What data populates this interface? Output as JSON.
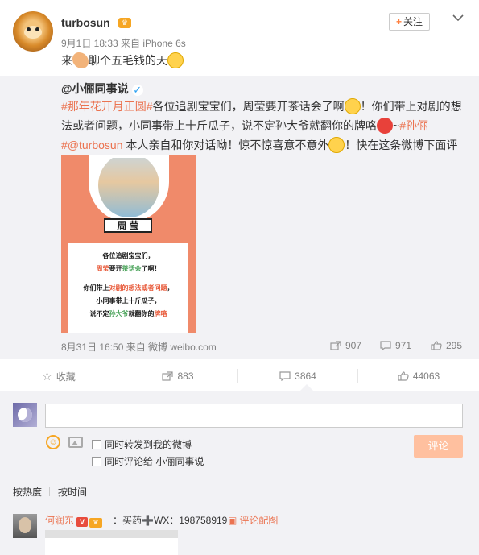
{
  "post": {
    "author": "turbosun",
    "vip_badge": "♛",
    "meta": "9月1日 18:33 来自 iPhone 6s",
    "text_before": "来",
    "text_middle": "聊个五毛钱的天",
    "follow_label": "关注",
    "follow_plus": "+",
    "more_icon": "chevron-down-icon"
  },
  "repost": {
    "author": "@小俪同事说",
    "verified": "✓",
    "topic": "#那年花开月正圆#",
    "p1": "各位追剧宝宝们，周莹要开茶话会了啊",
    "p2": "！你们带上对剧的想法或者问题，小同事带上十斤瓜子，说不定孙大爷就翻你的牌咯",
    "p3": "~",
    "mention1": "#孙俪#",
    "mention2": "@turbosun",
    "p4": " 本人亲自和你对话呦！惊不惊喜意不意外",
    "p5": "！快在这条微博下面评论起来吧！",
    "image": {
      "nameplate": "周 莹",
      "line1": "各位追剧宝宝们，",
      "line2a": "周莹",
      "line2b": "要开",
      "line2c": "茶话会",
      "line2d": "了啊！",
      "line3a": "你们带上",
      "line3b": "对剧的想法或者问题",
      "line3c": "，",
      "line4": "小同事带上十斤瓜子，",
      "line5a": "说不定",
      "line5b": "孙大爷",
      "line5c": "就翻你的",
      "line5d": "牌咯"
    },
    "meta": "8月31日 16:50 来自 微博 weibo.com",
    "reposts": "907",
    "comments": "971",
    "likes": "295"
  },
  "actions": {
    "favorite": "收藏",
    "repost": "883",
    "comment": "3864",
    "like": "44063"
  },
  "comment_box": {
    "placeholder": "",
    "check1": "同时转发到我的微博",
    "check2": "同时评论给 小俪同事说",
    "submit": "评论",
    "emoji": "☺"
  },
  "sort": {
    "by_hot": "按热度",
    "by_time": "按时间"
  },
  "top_comment": {
    "name": "何润东",
    "v": "V",
    "crown": "♛",
    "text": "：买药➕WX：198758919",
    "pic_link": "评论配图"
  },
  "colors": {
    "accent": "#eb7350",
    "link_orange": "#ff8140",
    "repost_bg": "#f2f2f5",
    "image_bg": "#f08a6a"
  }
}
